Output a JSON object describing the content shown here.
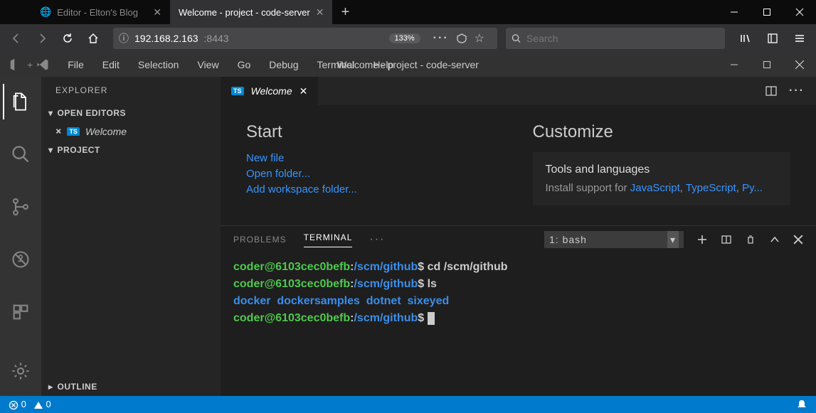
{
  "browser": {
    "tabs": [
      {
        "title": "Editor - Elton's Blog",
        "active": false
      },
      {
        "title": "Welcome - project - code-server",
        "active": true
      }
    ],
    "url_host": "192.168.2.163",
    "url_port": ":8443",
    "zoom": "133%",
    "search_placeholder": "Search"
  },
  "codeserver": {
    "title": "Welcome - project - code-server",
    "menu": [
      "File",
      "Edit",
      "Selection",
      "View",
      "Go",
      "Debug",
      "Terminal",
      "Help"
    ],
    "sidebar": {
      "title": "EXPLORER",
      "open_editors_label": "OPEN EDITORS",
      "project_label": "PROJECT",
      "outline_label": "OUTLINE",
      "open_file": {
        "lang": "TS",
        "name": "Welcome"
      }
    },
    "tab": {
      "lang": "TS",
      "name": "Welcome"
    },
    "welcome": {
      "start_heading": "Start",
      "links": [
        "New file",
        "Open folder...",
        "Add workspace folder..."
      ],
      "customize_heading": "Customize",
      "card_heading": "Tools and languages",
      "card_text_prefix": "Install support for ",
      "card_langs": [
        "JavaScript",
        "TypeScript",
        "Py..."
      ]
    },
    "panel": {
      "problems": "PROBLEMS",
      "terminal": "TERMINAL",
      "shell": "1: bash"
    },
    "terminal": {
      "prompt_user": "coder@6103cec0befb",
      "prompt_path": "/scm/github",
      "prompt_glyph": "$",
      "lines": [
        {
          "cmd": "cd /scm/github"
        },
        {
          "cmd": "ls"
        },
        {
          "out": [
            "docker",
            "dockersamples",
            "dotnet",
            "sixeyed"
          ]
        },
        {
          "cmd": ""
        }
      ]
    },
    "status": {
      "errors": "0",
      "warnings": "0"
    }
  }
}
